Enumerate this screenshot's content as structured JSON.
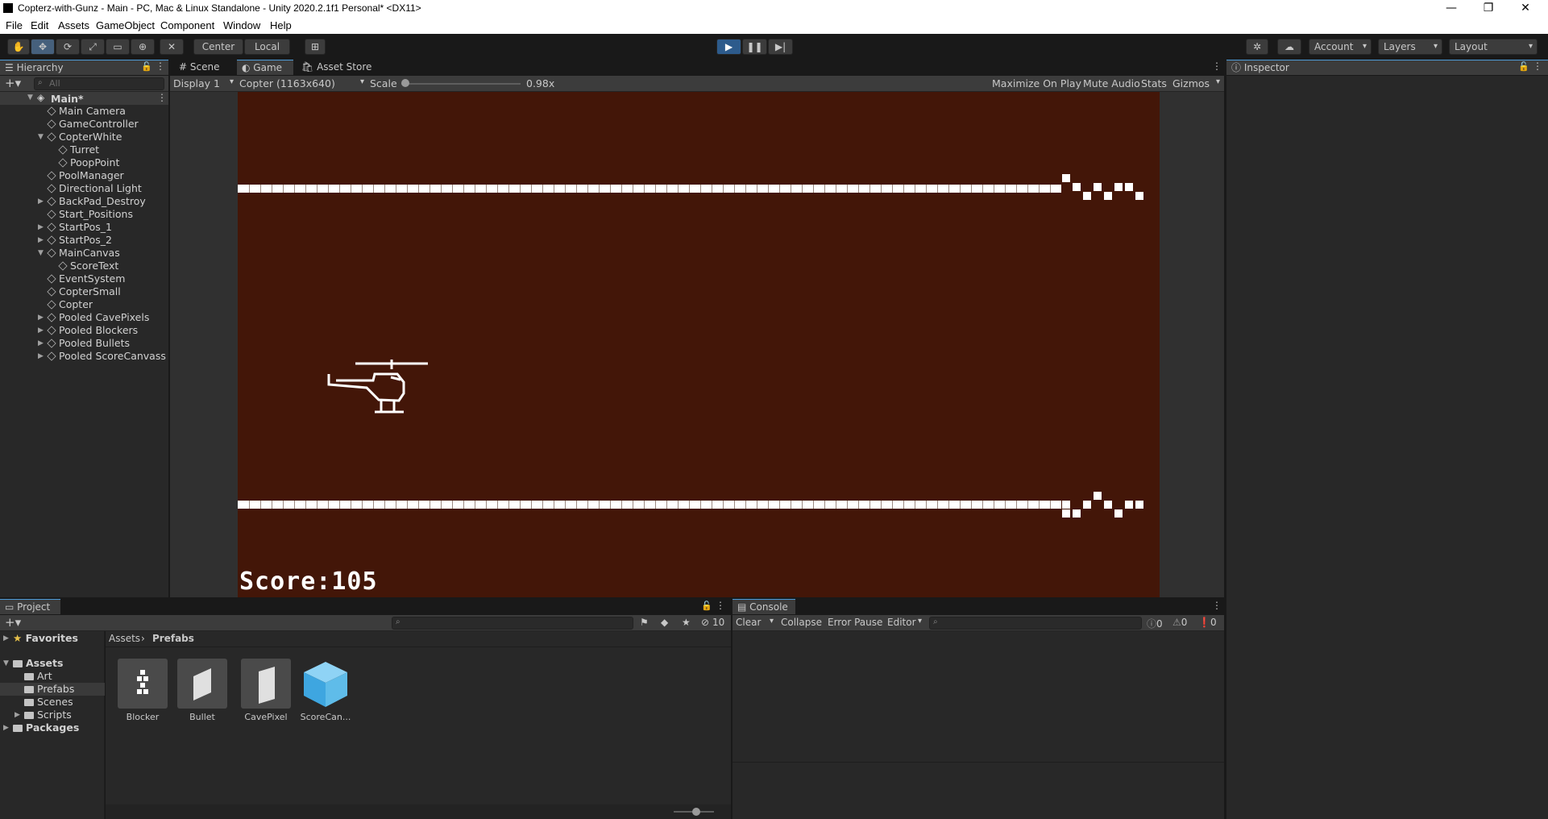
{
  "window": {
    "title": "Copterz-with-Gunz - Main - PC, Mac & Linux Standalone - Unity 2020.2.1f1 Personal* <DX11>",
    "minimize": "—",
    "maximize": "❐",
    "close": "✕"
  },
  "menu": [
    "File",
    "Edit",
    "Assets",
    "GameObject",
    "Component",
    "Window",
    "Help"
  ],
  "toolbar": {
    "pivot": "Center",
    "space": "Local",
    "account": "Account",
    "layers": "Layers",
    "layout": "Layout"
  },
  "hierarchy": {
    "tab": "Hierarchy",
    "search_placeholder": "All",
    "scene": "Main*",
    "items": [
      {
        "label": "Main Camera",
        "depth": 1,
        "expand": ""
      },
      {
        "label": "GameController",
        "depth": 1,
        "expand": ""
      },
      {
        "label": "CopterWhite",
        "depth": 1,
        "expand": "open"
      },
      {
        "label": "Turret",
        "depth": 2,
        "expand": ""
      },
      {
        "label": "PoopPoint",
        "depth": 2,
        "expand": ""
      },
      {
        "label": "PoolManager",
        "depth": 1,
        "expand": ""
      },
      {
        "label": "Directional Light",
        "depth": 1,
        "expand": ""
      },
      {
        "label": "BackPad_Destroy",
        "depth": 1,
        "expand": "closed"
      },
      {
        "label": "Start_Positions",
        "depth": 1,
        "expand": ""
      },
      {
        "label": "StartPos_1",
        "depth": 1,
        "expand": "closed"
      },
      {
        "label": "StartPos_2",
        "depth": 1,
        "expand": "closed"
      },
      {
        "label": "MainCanvas",
        "depth": 1,
        "expand": "open"
      },
      {
        "label": "ScoreText",
        "depth": 2,
        "expand": ""
      },
      {
        "label": "EventSystem",
        "depth": 1,
        "expand": ""
      },
      {
        "label": "CopterSmall",
        "depth": 1,
        "expand": ""
      },
      {
        "label": "Copter",
        "depth": 1,
        "expand": ""
      },
      {
        "label": "Pooled CavePixels",
        "depth": 1,
        "expand": "closed"
      },
      {
        "label": "Pooled Blockers",
        "depth": 1,
        "expand": "closed"
      },
      {
        "label": "Pooled Bullets",
        "depth": 1,
        "expand": "closed"
      },
      {
        "label": "Pooled ScoreCanvass",
        "depth": 1,
        "expand": "closed"
      }
    ]
  },
  "center_tabs": [
    "Scene",
    "Game",
    "Asset Store"
  ],
  "game_bar": {
    "display": "Display 1",
    "resolution": "Copter (1163x640)",
    "scale_label": "Scale",
    "scale_value": "0.98x",
    "scale_fraction": 0.0,
    "maximize": "Maximize On Play",
    "mute": "Mute Audio",
    "stats": "Stats",
    "gizmos": "Gizmos"
  },
  "game": {
    "score_text": "Score:105",
    "background": "#431608"
  },
  "inspector": {
    "tab": "Inspector"
  },
  "project": {
    "tab": "Project",
    "favorites": "Favorites",
    "assets": "Assets",
    "folders": [
      "Art",
      "Prefabs",
      "Scenes",
      "Scripts"
    ],
    "packages": "Packages",
    "breadcrumb_root": "Assets",
    "breadcrumb_current": "Prefabs",
    "hidden_count": "10",
    "items": [
      "Blocker",
      "Bullet",
      "CavePixel",
      "ScoreCan..."
    ]
  },
  "console": {
    "tab": "Console",
    "clear": "Clear",
    "collapse": "Collapse",
    "error_pause": "Error Pause",
    "editor": "Editor",
    "log_count": "0",
    "warn_count": "0",
    "error_count": "0"
  },
  "colors": {
    "accent": "#4d9bd8",
    "play_active": "#2d5b8c"
  }
}
